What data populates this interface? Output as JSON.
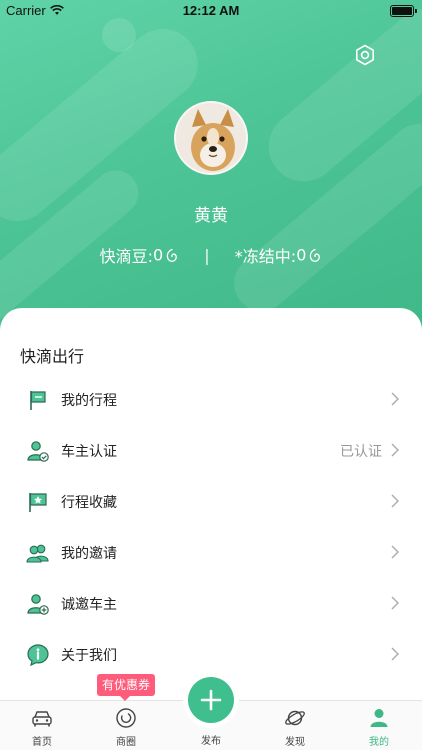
{
  "status_bar": {
    "carrier": "Carrier",
    "time": "12:12 AM"
  },
  "profile": {
    "name": "黄黄",
    "beans_label": "快滴豆:",
    "beans_value": "0",
    "separator": "|",
    "frozen_label": "*冻结中:",
    "frozen_value": "0"
  },
  "section": {
    "title": "快滴出行"
  },
  "menu": [
    {
      "label": "我的行程",
      "icon": "flag-icon",
      "value": ""
    },
    {
      "label": "车主认证",
      "icon": "user-verified-icon",
      "value": "已认证"
    },
    {
      "label": "行程收藏",
      "icon": "star-flag-icon",
      "value": ""
    },
    {
      "label": "我的邀请",
      "icon": "users-icon",
      "value": ""
    },
    {
      "label": "诚邀车主",
      "icon": "user-add-icon",
      "value": ""
    },
    {
      "label": "关于我们",
      "icon": "info-bubble-icon",
      "value": ""
    }
  ],
  "coupon_badge": "有优惠券",
  "tabbar": {
    "items": [
      {
        "label": "首页",
        "icon": "car-icon"
      },
      {
        "label": "商圈",
        "icon": "circle-icon"
      },
      {
        "label": "发布",
        "icon": "plus-icon"
      },
      {
        "label": "发现",
        "icon": "planet-icon"
      },
      {
        "label": "我的",
        "icon": "person-icon"
      }
    ],
    "active_index": 4
  },
  "colors": {
    "accent": "#3fb787",
    "coupon": "#ff5b7a"
  }
}
